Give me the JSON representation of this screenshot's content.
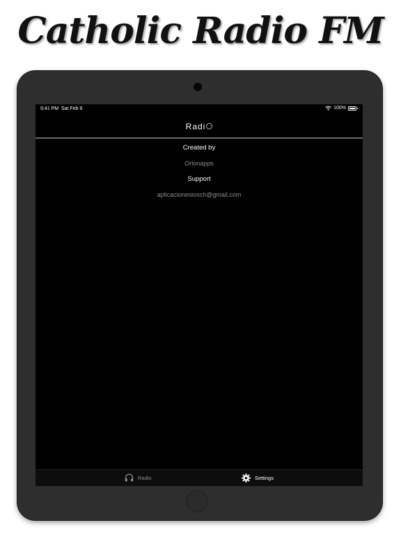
{
  "promo": {
    "title": "Catholic Radio FM"
  },
  "status_bar": {
    "time": "9:41 PM",
    "date": "Sat Feb 8",
    "battery": "100%"
  },
  "nav": {
    "title_prefix": "Radi"
  },
  "settings": {
    "created_by_label": "Created by",
    "created_by_value": "Orionapps",
    "support_label": "Support",
    "support_value": "aplicacionesiosch@gmail.com"
  },
  "tabs": [
    {
      "label": "Radio",
      "icon": "headphones-icon",
      "selected": false
    },
    {
      "label": "Settings",
      "icon": "gear-icon",
      "selected": true
    }
  ],
  "colors": {
    "accent": "#ffffff",
    "muted": "#8e8e8e",
    "background": "#000000",
    "bezel": "#2e2e2e"
  }
}
